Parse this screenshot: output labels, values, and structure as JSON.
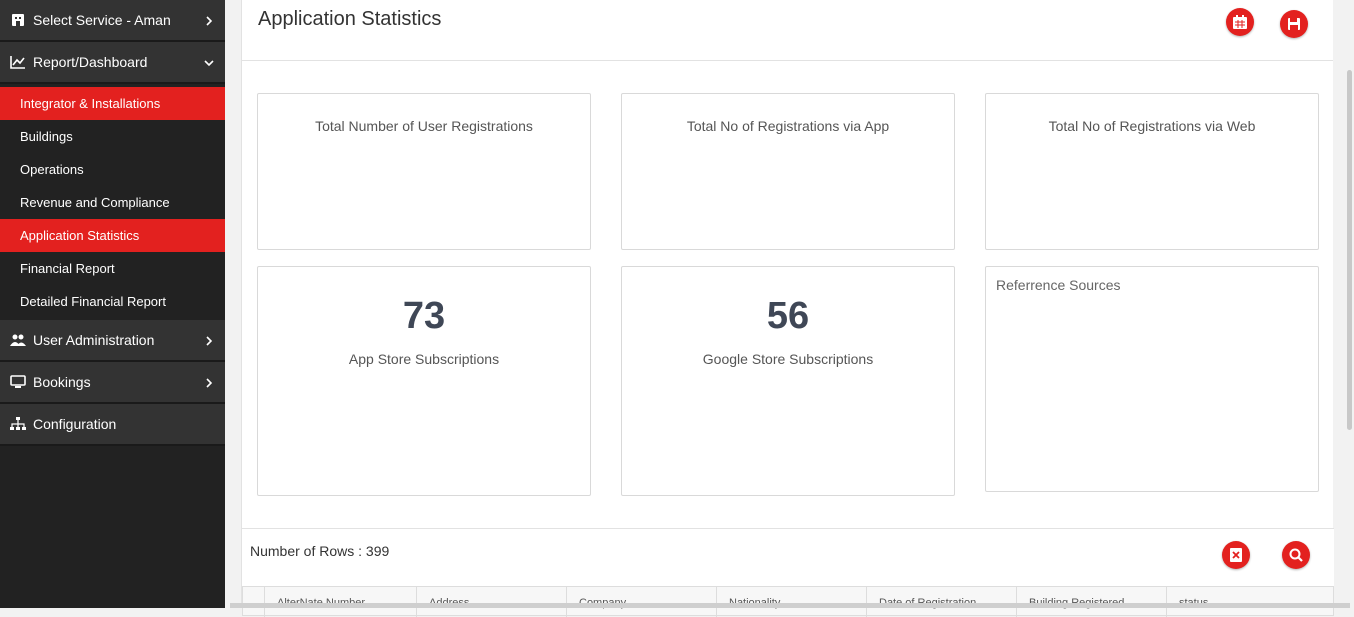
{
  "sidebar": {
    "select_service": "Select Service - Aman",
    "report_dashboard": "Report/Dashboard",
    "report_items": [
      {
        "label": "Integrator & Installations",
        "active": true
      },
      {
        "label": "Buildings",
        "active": false
      },
      {
        "label": "Operations",
        "active": false
      },
      {
        "label": "Revenue and Compliance",
        "active": false
      },
      {
        "label": "Application Statistics",
        "active": true
      },
      {
        "label": "Financial Report",
        "active": false
      },
      {
        "label": "Detailed Financial Report",
        "active": false
      }
    ],
    "user_administration": "User Administration",
    "bookings": "Bookings",
    "configuration": "Configuration"
  },
  "header": {
    "title": "Application Statistics",
    "calendar_icon": "calendar-icon",
    "save_icon": "save-icon"
  },
  "cards": {
    "user_registrations": "Total Number of User Registrations",
    "app_registrations": "Total No of Registrations via App",
    "web_registrations": "Total No of Registrations via Web",
    "app_store": {
      "value": "73",
      "label": "App Store Subscriptions"
    },
    "google_store": {
      "value": "56",
      "label": "Google Store Subscriptions"
    },
    "reference_sources": "Referrence Sources"
  },
  "table": {
    "rows_label": "Number of Rows : 399",
    "columns": [
      "AlterNate Number",
      "Address",
      "Company",
      "Nationality",
      "Date of Registration",
      "Building Registered",
      "status"
    ]
  },
  "colors": {
    "accent": "#e3211f",
    "sidebar_bg": "#222222",
    "sidebar_header_bg": "#333333"
  }
}
